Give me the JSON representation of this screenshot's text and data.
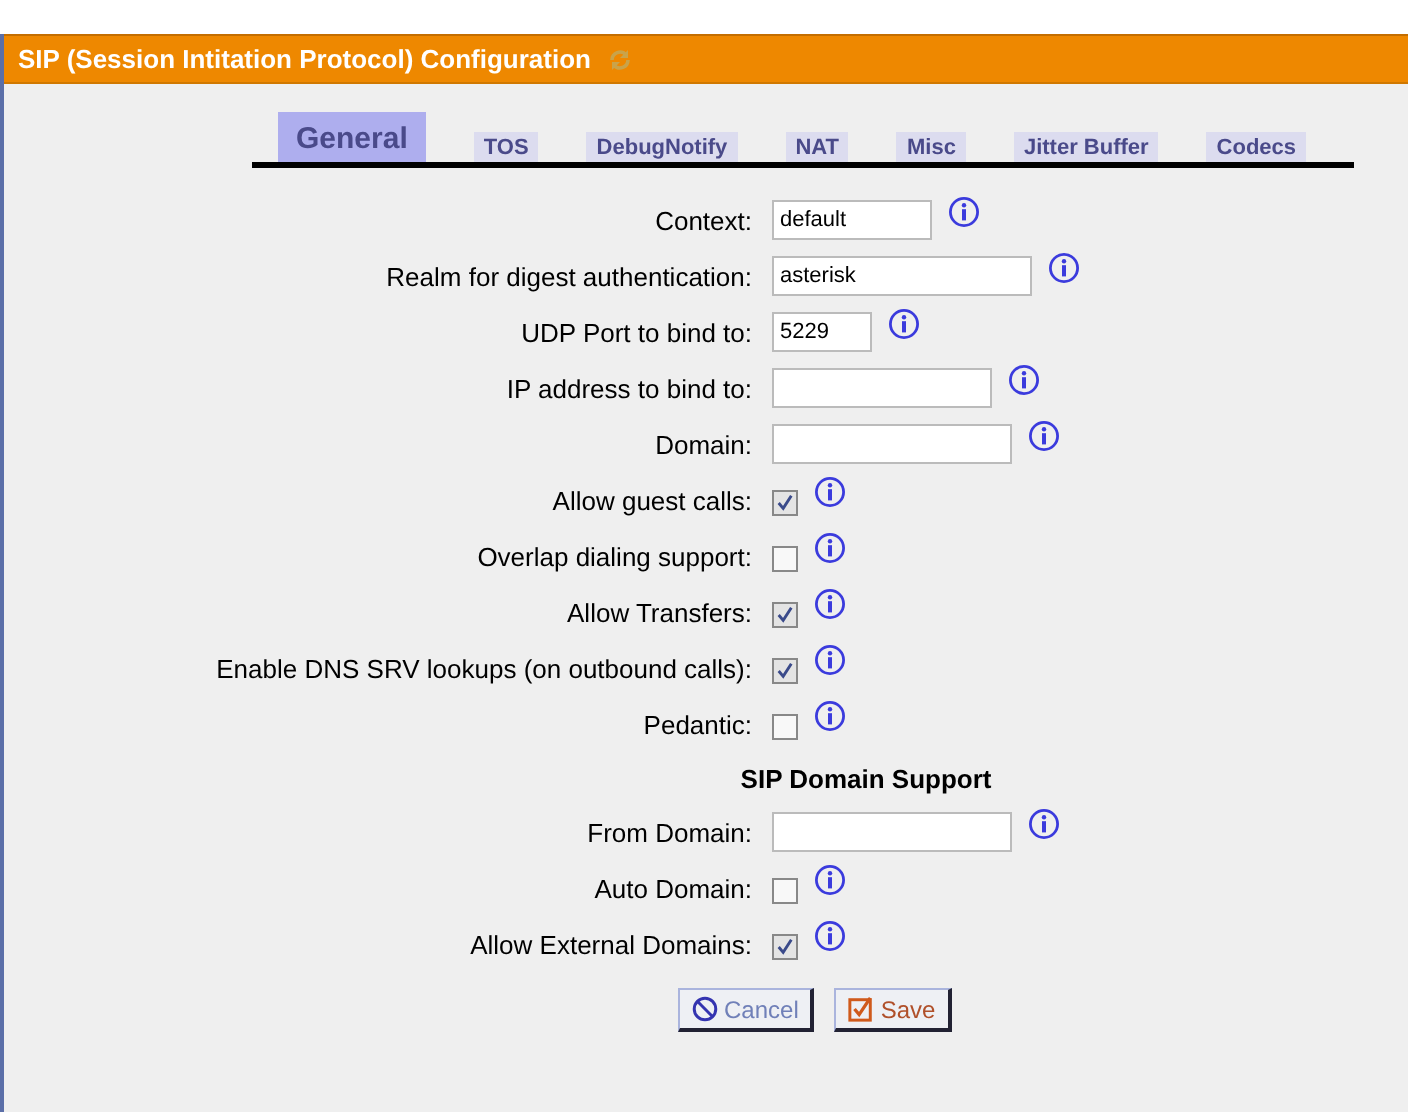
{
  "header": {
    "title": "SIP (Session Intitation Protocol) Configuration"
  },
  "tabs": [
    {
      "label": "General",
      "selected": true
    },
    {
      "label": "TOS",
      "selected": false
    },
    {
      "label": "DebugNotify",
      "selected": false
    },
    {
      "label": "NAT",
      "selected": false
    },
    {
      "label": "Misc",
      "selected": false
    },
    {
      "label": "Jitter Buffer",
      "selected": false
    },
    {
      "label": "Codecs",
      "selected": false
    }
  ],
  "rows": [
    {
      "kind": "field",
      "label": "Context:",
      "value": "default"
    },
    {
      "kind": "field",
      "label": "Realm for digest authentication:",
      "value": "asterisk"
    },
    {
      "kind": "field",
      "label": "UDP Port to bind to:",
      "value": "5229"
    },
    {
      "kind": "field",
      "label": "IP address to bind to:"
    },
    {
      "kind": "field",
      "label": "Domain:"
    },
    {
      "kind": "checkbox",
      "label": "Allow guest calls:",
      "checked": true
    },
    {
      "kind": "checkbox",
      "label": "Overlap dialing support:",
      "checked": false
    },
    {
      "kind": "checkbox",
      "label": "Allow Transfers:",
      "checked": true
    },
    {
      "kind": "checkbox",
      "label": "Enable DNS SRV lookups (on outbound calls):",
      "checked": true
    },
    {
      "kind": "checkbox",
      "label": "Pedantic:",
      "checked": false
    },
    {
      "kind": "section",
      "label": "SIP Domain Support"
    },
    {
      "kind": "field",
      "label": "From Domain:"
    },
    {
      "kind": "checkbox",
      "label": "Auto Domain:",
      "checked": false
    },
    {
      "kind": "checkbox",
      "label": "Allow External Domains:",
      "checked": true
    }
  ],
  "buttons": [
    {
      "kind": "cancel",
      "label": "Cancel"
    },
    {
      "kind": "save",
      "label": "Save"
    }
  ]
}
